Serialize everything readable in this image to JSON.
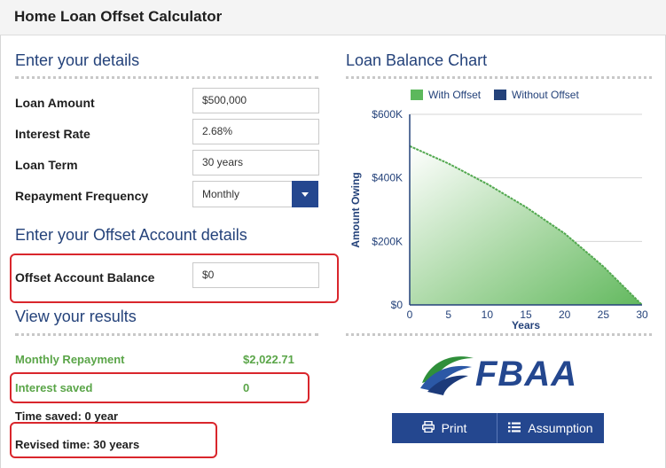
{
  "header": {
    "title": "Home Loan Offset Calculator"
  },
  "details": {
    "heading": "Enter your details",
    "loan_amount": {
      "label": "Loan Amount",
      "value": "$500,000"
    },
    "interest_rate": {
      "label": "Interest Rate",
      "value": "2.68%"
    },
    "loan_term": {
      "label": "Loan Term",
      "value": "30 years"
    },
    "repayment_frequency": {
      "label": "Repayment Frequency",
      "value": "Monthly"
    }
  },
  "offset": {
    "heading": "Enter your Offset Account details",
    "balance": {
      "label": "Offset Account Balance",
      "value": "$0"
    }
  },
  "results": {
    "heading": "View your results",
    "monthly_repayment": {
      "label": "Monthly Repayment",
      "value": "$2,022.71"
    },
    "interest_saved": {
      "label": "Interest saved",
      "value": "0"
    },
    "time_saved": "Time saved: 0 year",
    "revised_time": "Revised time: 30 years"
  },
  "chart_heading": "Loan Balance Chart",
  "chart_data": {
    "type": "area",
    "title": "",
    "xlabel": "Years",
    "ylabel": "Amount Owing",
    "x_ticks": [
      "0",
      "5",
      "10",
      "15",
      "20",
      "25",
      "30"
    ],
    "y_ticks": [
      "$0",
      "$200K",
      "$400K",
      "$600K"
    ],
    "xlim": [
      0,
      30
    ],
    "ylim": [
      0,
      600000
    ],
    "legend_position": "top",
    "series": [
      {
        "name": "With Offset",
        "color": "#5cb85c",
        "x": [
          0,
          5,
          10,
          15,
          20,
          25,
          30
        ],
        "values": [
          500000,
          445000,
          381000,
          308000,
          225000,
          121000,
          0
        ]
      },
      {
        "name": "Without Offset",
        "color": "#24427a",
        "x": [
          0,
          5,
          10,
          15,
          20,
          25,
          30
        ],
        "values": [
          500000,
          445000,
          381000,
          308000,
          225000,
          121000,
          0
        ]
      }
    ]
  },
  "brand": {
    "logo_text": "FBAA"
  },
  "actions": {
    "print_label": "Print",
    "assumption_label": "Assumption"
  }
}
